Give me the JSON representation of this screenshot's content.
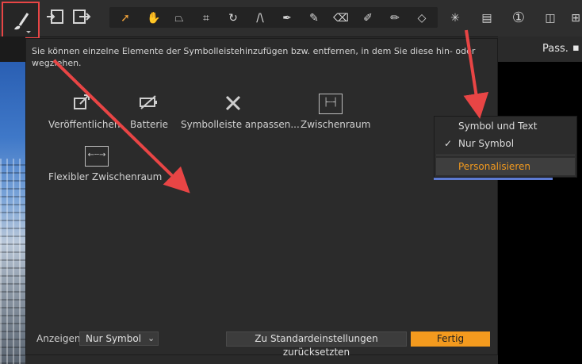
{
  "dialog": {
    "description": "Sie können einzelne Elemente der Symbolleistehinzufügen bzw. entfernen, in dem Sie diese hin- oder wegziehen.",
    "items": [
      {
        "label": "Veröffentlichen",
        "icon": "publish-icon"
      },
      {
        "label": "Batterie",
        "icon": "battery-icon"
      },
      {
        "label": "Symbolleiste anpassen...",
        "icon": "customize-toolbar-icon"
      },
      {
        "label": "Zwischenraum",
        "icon": "space-icon"
      },
      {
        "label": "Flexibler Zwischenraum",
        "icon": "flexible-space-icon"
      }
    ],
    "show_label": "Anzeigen",
    "show_value": "Nur Symbol",
    "reset_label": "Zu Standardeinstellungen zurücksetzten",
    "done_label": "Fertig"
  },
  "context_menu": {
    "items": [
      {
        "label": "Symbol und Text",
        "checked": false
      },
      {
        "label": "Nur Symbol",
        "checked": true
      },
      {
        "label": "Personalisieren",
        "highlighted": true
      }
    ],
    "check_glyph": "✓"
  },
  "header": {
    "pass_label": "Pass."
  },
  "colors": {
    "accent": "#f39a1e",
    "highlight_border": "#e84545",
    "arrow": "#e84545"
  }
}
